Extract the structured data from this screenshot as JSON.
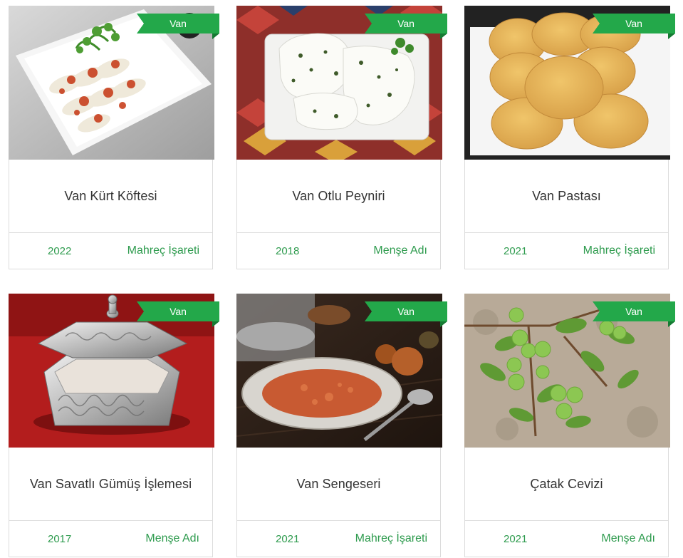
{
  "products": [
    {
      "region": "Van",
      "name": "Van Kürt Köftesi",
      "year": "2022",
      "indication": "Mahreç İşareti",
      "image_icon": "kurt-koftesi-photo"
    },
    {
      "region": "Van",
      "name": "Van Otlu Peyniri",
      "year": "2018",
      "indication": "Menşe Adı",
      "image_icon": "otlu-peynir-photo"
    },
    {
      "region": "Van",
      "name": "Van Pastası",
      "year": "2021",
      "indication": "Mahreç İşareti",
      "image_icon": "van-pastasi-photo"
    },
    {
      "region": "Van",
      "name": "Van Savatlı Gümüş İşlemesi",
      "year": "2017",
      "indication": "Menşe Adı",
      "image_icon": "silver-box-photo"
    },
    {
      "region": "Van",
      "name": "Van Sengeseri",
      "year": "2021",
      "indication": "Mahreç İşareti",
      "image_icon": "sengeseri-photo"
    },
    {
      "region": "Van",
      "name": "Çatak Cevizi",
      "year": "2021",
      "indication": "Menşe Adı",
      "image_icon": "walnut-tree-photo"
    }
  ],
  "colors": {
    "ribbon": "#23a84a",
    "accent_text": "#2e9b4e",
    "title_text": "#333333",
    "border": "#dcdcdc"
  }
}
